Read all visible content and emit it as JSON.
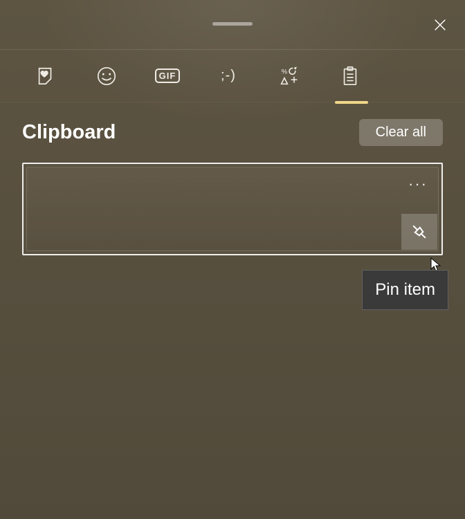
{
  "header": {
    "title": "Clipboard",
    "clear_label": "Clear all"
  },
  "tabs": {
    "recent": "recent",
    "emoji": "emoji",
    "gif_label": "GIF",
    "kaomoji_label": ";-)",
    "symbols": "symbols",
    "clipboard": "clipboard"
  },
  "item": {
    "more_label": "···"
  },
  "tooltip": {
    "pin_label": "Pin item"
  }
}
